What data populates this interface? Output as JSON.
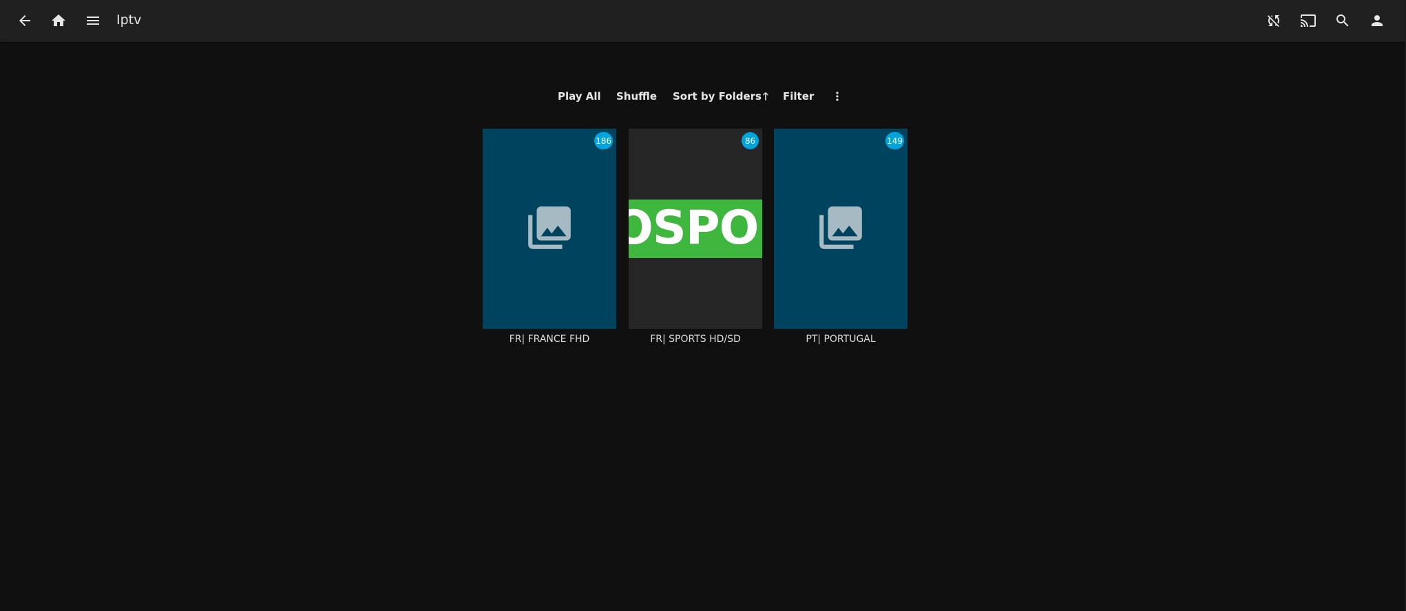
{
  "header": {
    "title": "Iptv",
    "icons": {
      "back": "arrow-back-icon",
      "home": "home-icon",
      "menu": "hamburger-menu-icon",
      "sync": "sync-disabled-icon",
      "cast": "cast-icon",
      "search": "search-icon",
      "user": "user-icon"
    }
  },
  "toolbar": {
    "play_all": "Play All",
    "shuffle": "Shuffle",
    "sort": "Sort by Folders",
    "sort_direction_icon": "arrow-up-icon",
    "filter": "Filter",
    "more_icon": "more-vert-icon"
  },
  "items": [
    {
      "title": "FR| FRANCE FHD",
      "count": "186",
      "image": "folder-placeholder-icon"
    },
    {
      "title": "FR| SPORTS HD/SD",
      "count": "86",
      "logo_text": "OSPOR"
    },
    {
      "title": "PT| PORTUGAL",
      "count": "149",
      "image": "folder-placeholder-icon"
    }
  ],
  "colors": {
    "background": "#101010",
    "header": "#202020",
    "folder_tile": "#00435e",
    "badge": "#00a4dc",
    "logo_green": "#3fb73f"
  }
}
